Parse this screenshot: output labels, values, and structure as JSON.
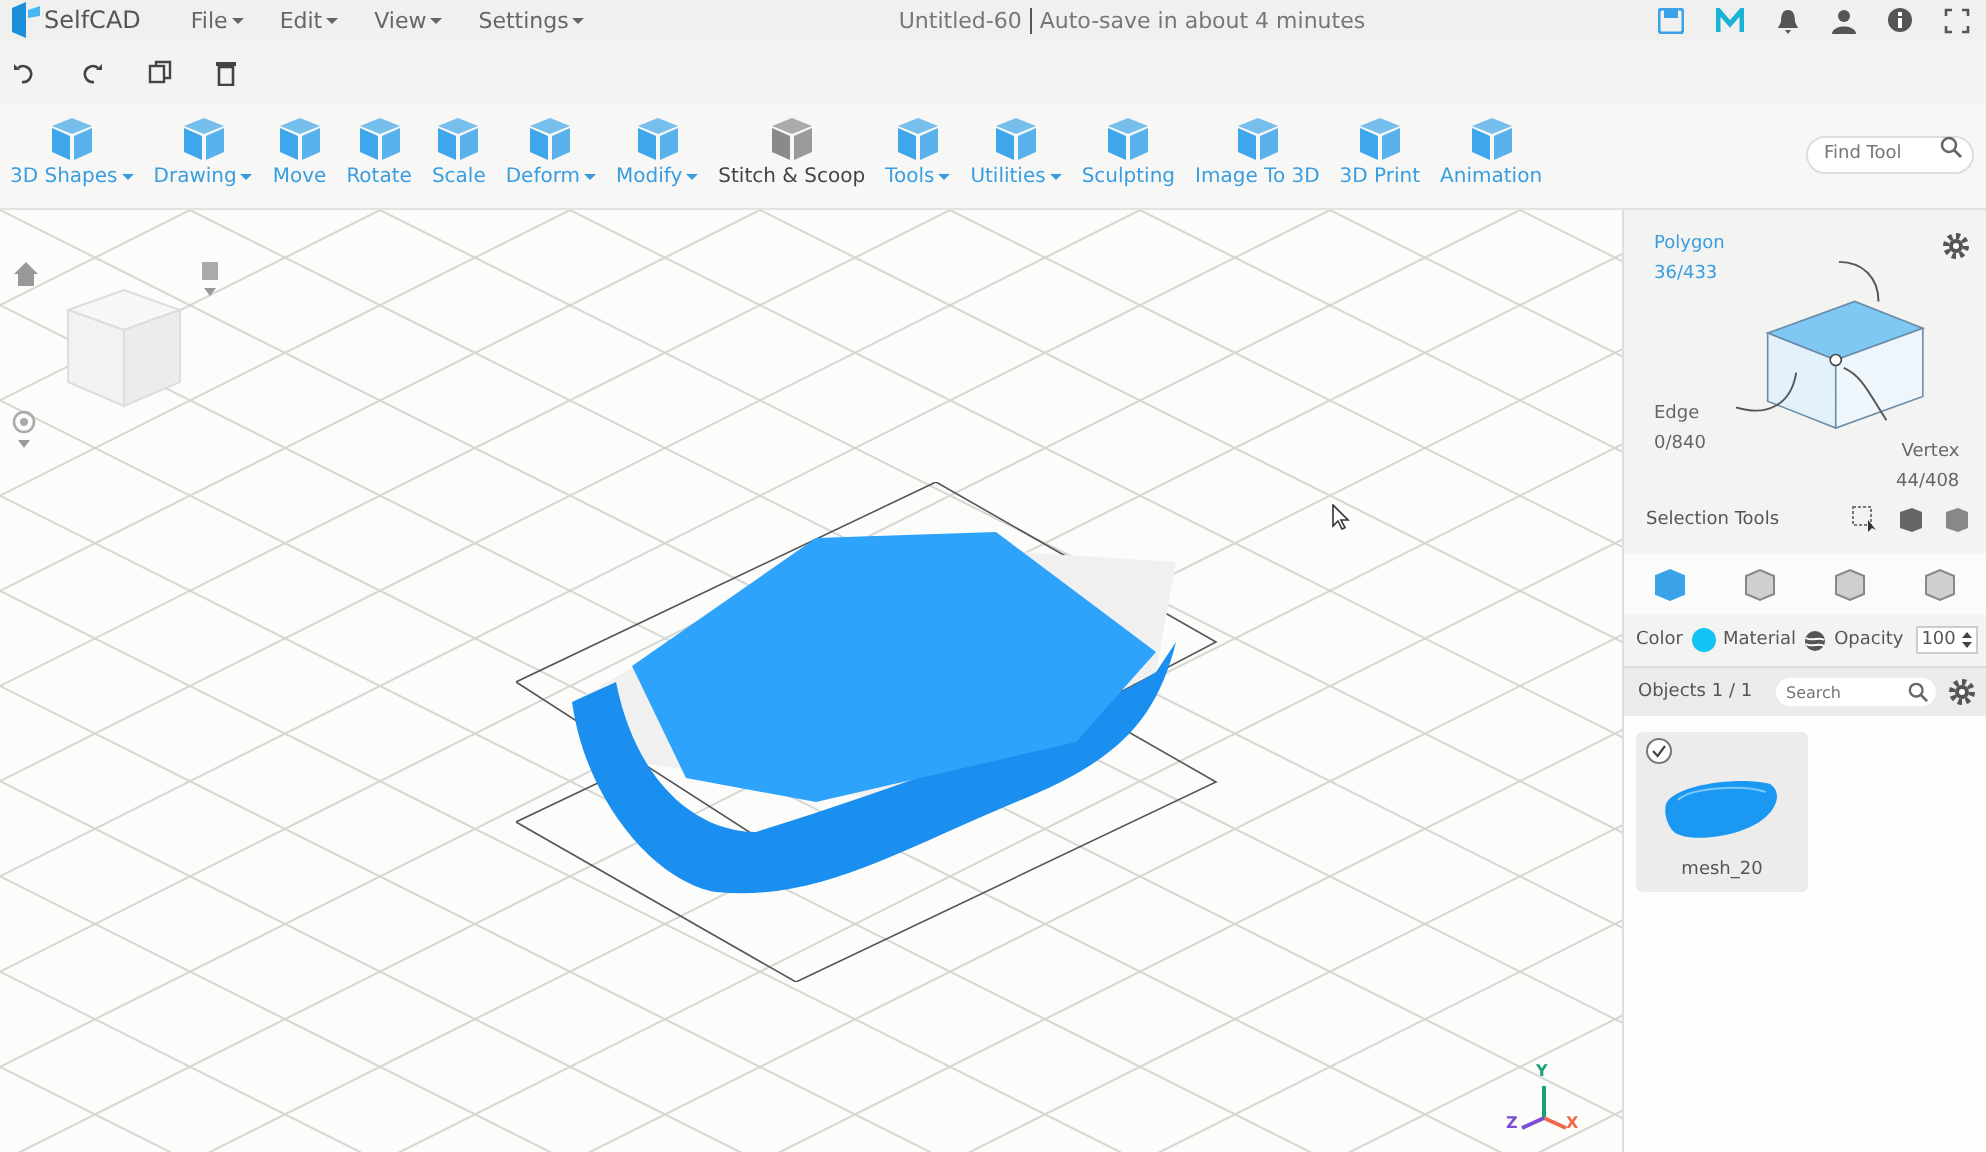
{
  "header": {
    "brand": "SelfCAD",
    "menus": [
      {
        "label": "File",
        "dropdown": true
      },
      {
        "label": "Edit",
        "dropdown": true
      },
      {
        "label": "View",
        "dropdown": true
      },
      {
        "label": "Settings",
        "dropdown": true
      }
    ],
    "document_title": "Untitled-60",
    "autosave": "Auto-save in about 4 minutes"
  },
  "toolbar": {
    "tools": [
      {
        "label": "3D Shapes",
        "dropdown": true,
        "dimmed": false
      },
      {
        "label": "Drawing",
        "dropdown": true,
        "dimmed": false
      },
      {
        "label": "Move",
        "dropdown": false,
        "dimmed": false
      },
      {
        "label": "Rotate",
        "dropdown": false,
        "dimmed": false
      },
      {
        "label": "Scale",
        "dropdown": false,
        "dimmed": false
      },
      {
        "label": "Deform",
        "dropdown": true,
        "dimmed": false
      },
      {
        "label": "Modify",
        "dropdown": true,
        "dimmed": false
      },
      {
        "label": "Stitch & Scoop",
        "dropdown": false,
        "dimmed": true
      },
      {
        "label": "Tools",
        "dropdown": true,
        "dimmed": false
      },
      {
        "label": "Utilities",
        "dropdown": true,
        "dimmed": false
      },
      {
        "label": "Sculpting",
        "dropdown": false,
        "dimmed": false
      },
      {
        "label": "Image To 3D",
        "dropdown": false,
        "dimmed": false
      },
      {
        "label": "3D Print",
        "dropdown": false,
        "dimmed": false
      },
      {
        "label": "Animation",
        "dropdown": false,
        "dimmed": false
      }
    ],
    "find_tool": {
      "placeholder": "Find Tool"
    }
  },
  "viewport": {
    "axes": [
      {
        "label": "Y",
        "color": "#1aa37a"
      },
      {
        "label": "Z",
        "color": "#7a4fd6"
      },
      {
        "label": "X",
        "color": "#ee6a4a"
      }
    ]
  },
  "selection_panel": {
    "modes": [
      {
        "label": "Polygon",
        "count": "36/433",
        "selected": true
      },
      {
        "label": "Edge",
        "count": "0/840",
        "selected": false
      },
      {
        "label": "Vertex",
        "count": "44/408",
        "selected": false
      }
    ],
    "tools_label": "Selection Tools",
    "view_modes": [
      {
        "selected": true
      },
      {
        "selected": false
      },
      {
        "selected": false
      },
      {
        "selected": false
      }
    ]
  },
  "appearance": {
    "color_label": "Color",
    "color": "#12c4f4",
    "material_label": "Material",
    "opacity_label": "Opacity",
    "opacity": "100"
  },
  "objects": {
    "title": "Objects 1 / 1",
    "search_placeholder": "Search",
    "items": [
      {
        "name": "mesh_20",
        "checked": true
      }
    ]
  }
}
